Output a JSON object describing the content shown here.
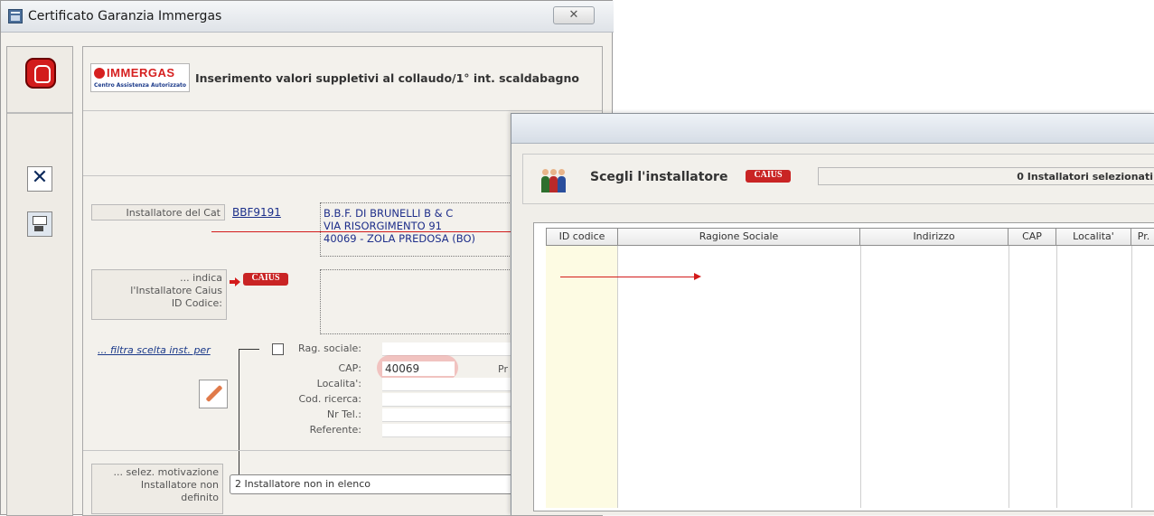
{
  "window": {
    "title": "Certificato Garanzia Immergas",
    "close_label": "✕"
  },
  "header": {
    "brand": "IMMERGAS",
    "brand_sub": "Centro Assistenza Autorizzato",
    "title": "Inserimento valori suppletivi al collaudo/1° int. scaldabagno"
  },
  "installer": {
    "label": "Installatore del Cat",
    "code": "BBF9191",
    "address_lines": [
      "B.B.F. DI BRUNELLI B & C",
      "VIA RISORGIMENTO 91",
      "40069 - ZOLA PREDOSA (BO)"
    ]
  },
  "caius": {
    "indicate_label_lines": [
      "... indica",
      "l'Installatore Caius",
      "ID Codice:"
    ],
    "logo_text": "CAIUS"
  },
  "filter": {
    "link": "... filtra scelta inst. per",
    "fields": [
      "Rag. sociale:",
      "CAP:",
      "Localita':",
      "Cod. ricerca:",
      "Nr Tel.:",
      "Referente:"
    ],
    "cap_value": "40069",
    "pr_label": "Pr"
  },
  "motivation": {
    "label_lines": [
      "... selez. motivazione",
      "Installatore non",
      "definito"
    ],
    "selected": "2   Installatore non in elenco"
  },
  "popup": {
    "heading": "Scegli l'installatore",
    "logo_text": "CAIUS",
    "count_text": "0 Installatori selezionati",
    "columns": [
      "ID codice",
      "Ragione Sociale",
      "Indirizzo",
      "CAP",
      "Localita'",
      "Pr."
    ]
  }
}
